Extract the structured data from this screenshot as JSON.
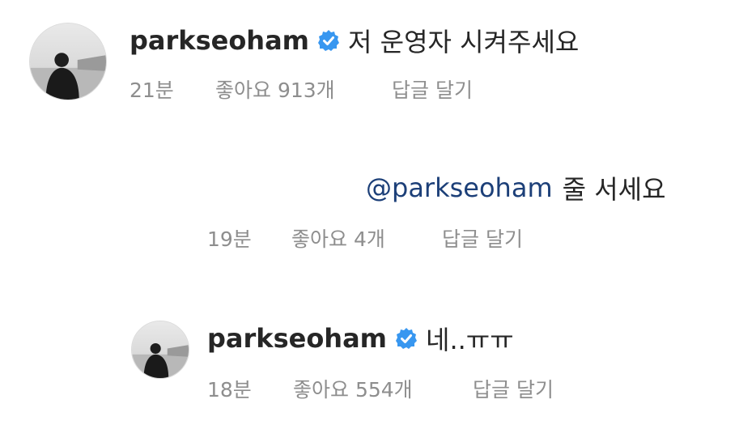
{
  "comments": [
    {
      "username": "parkseoham",
      "verified": true,
      "text": "저 운영자 시켜주세요",
      "time": "21분",
      "likes": "좋아요 913개",
      "reply": "답글 달기"
    },
    {
      "mention": "@parkseoham",
      "text": "줄 서세요",
      "time": "19분",
      "likes": "좋아요 4개",
      "reply": "답글 달기"
    },
    {
      "username": "parkseoham",
      "verified": true,
      "text": "네..ㅠㅠ",
      "time": "18분",
      "likes": "좋아요 554개",
      "reply": "답글 달기"
    }
  ],
  "colors": {
    "verified_badge": "#3897f0",
    "mention": "#1c3f78",
    "meta": "#8e8e8e",
    "text": "#262626"
  },
  "icons": {
    "verified": "verified-badge-icon",
    "avatar": "profile-photo"
  }
}
